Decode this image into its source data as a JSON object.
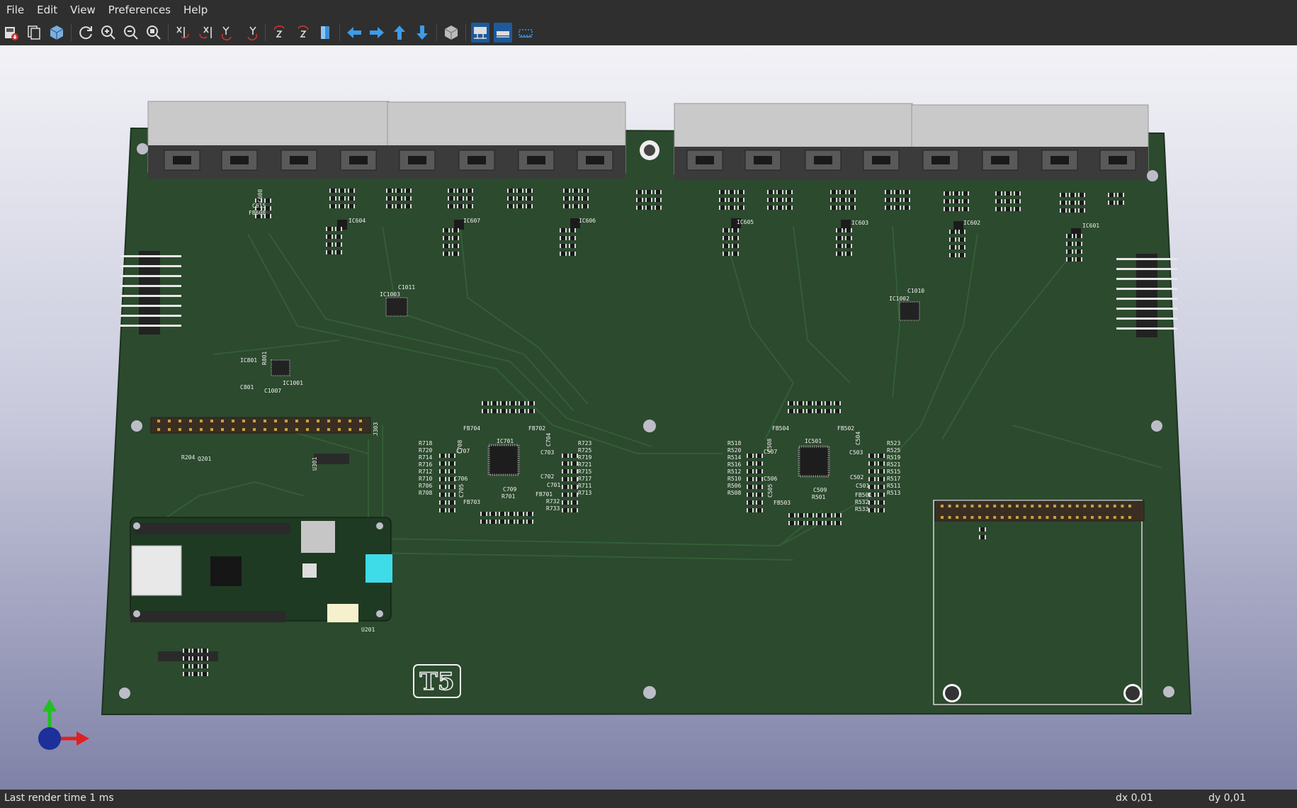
{
  "menu": {
    "file": "File",
    "edit": "Edit",
    "view": "View",
    "preferences": "Preferences",
    "help": "Help"
  },
  "toolbar": {
    "icons": [
      "save-image-icon",
      "copy-icon",
      "render-icon",
      "reload-icon",
      "zoom-in-icon",
      "zoom-out-icon",
      "zoom-fit-icon",
      "rotate-x-cw-icon",
      "rotate-x-ccw-icon",
      "rotate-y-cw-icon",
      "rotate-y-ccw-icon",
      "rotate-z-cw-icon",
      "rotate-z-ccw-icon",
      "flip-board-icon",
      "move-left-icon",
      "move-right-icon",
      "move-up-icon",
      "move-down-icon",
      "ortho-icon",
      "show-tht-icon",
      "show-smd-icon",
      "show-virtual-icon"
    ]
  },
  "board": {
    "logo_text": "T5",
    "labels": {
      "ic1003": "IC1003",
      "c1011": "C1011",
      "ic1002": "IC1002",
      "c1010": "C1010",
      "ic801": "IC801",
      "r801": "R801",
      "ic1001": "IC1001",
      "c801": "C801",
      "c1007": "C1007",
      "j303": "J303",
      "r204": "R204",
      "q201": "Q201",
      "ic701": "IC701",
      "fb704": "FB704",
      "fb702": "FB702",
      "c708": "C708",
      "c707": "C707",
      "c704": "C704",
      "c703": "C703",
      "c706": "C706",
      "c705": "C705",
      "c709": "C709",
      "c702": "C702",
      "c701": "C701",
      "fb703": "FB703",
      "fb701": "FB701",
      "r701": "R701",
      "r732": "R732",
      "r733": "R733",
      "ic501": "IC501",
      "fb504": "FB504",
      "fb502": "FB502",
      "c508": "C508",
      "c507": "C507",
      "c504": "C504",
      "c503": "C503",
      "c506": "C506",
      "c505": "C505",
      "c509": "C509",
      "c502": "C502",
      "c501": "C501",
      "fb503": "FB503",
      "fb501": "FB501",
      "r501": "R501",
      "r532": "R532",
      "r533": "R533",
      "u201": "U201",
      "u301": "U301",
      "ic604": "IC604",
      "ic607": "IC607",
      "ic606": "IC606",
      "ic605": "IC605",
      "ic603": "IC603",
      "ic602": "IC602",
      "ic601": "IC601",
      "fb608": "FB608",
      "c615": "C615",
      "c608": "C608"
    },
    "left_resistors": [
      "R718",
      "R720",
      "R714",
      "R716",
      "R712",
      "R710",
      "R706",
      "R708"
    ],
    "right_resistors_700": [
      "R723",
      "R725",
      "R719",
      "R721",
      "R715",
      "R717",
      "R711",
      "R713"
    ],
    "left_resistors_500": [
      "R518",
      "R520",
      "R514",
      "R516",
      "R512",
      "R510",
      "R506",
      "R508"
    ],
    "right_resistors_500": [
      "R523",
      "R525",
      "R519",
      "R521",
      "R515",
      "R517",
      "R511",
      "R513"
    ]
  },
  "status": {
    "render_time": "Last render time 1 ms",
    "dx": "dx 0,01",
    "dy": "dy 0,01"
  }
}
